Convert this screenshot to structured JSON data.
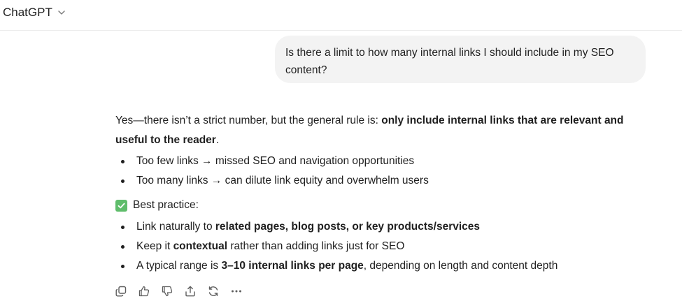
{
  "header": {
    "model_name": "ChatGPT"
  },
  "conversation": {
    "user_message": "Is there a limit to how many internal links I should include in my SEO content?",
    "assistant": {
      "intro_plain": "Yes—there isn’t a strict number, but the general rule is: ",
      "intro_bold": "only include internal links that are relevant and useful to the reader",
      "intro_end": ".",
      "points": [
        "Too few links → missed SEO and navigation opportunities",
        "Too many links → can dilute link equity and overwhelm users"
      ],
      "best_practice_label": "Best practice:",
      "practices": [
        {
          "pre": "Link naturally to ",
          "bold": "related pages, blog posts, or key products/services",
          "post": ""
        },
        {
          "pre": "Keep it ",
          "bold": "contextual",
          "post": " rather than adding links just for SEO"
        },
        {
          "pre": "A typical range is ",
          "bold": "3–10 internal links per page",
          "post": ", depending on length and content depth"
        }
      ]
    }
  },
  "action_bar": {
    "icons": [
      "copy-icon",
      "thumbs-up-icon",
      "thumbs-down-icon",
      "share-icon",
      "regenerate-icon",
      "more-icon"
    ]
  },
  "colors": {
    "check_green": "#5fbd6b",
    "bubble_bg": "#f3f3f3"
  }
}
